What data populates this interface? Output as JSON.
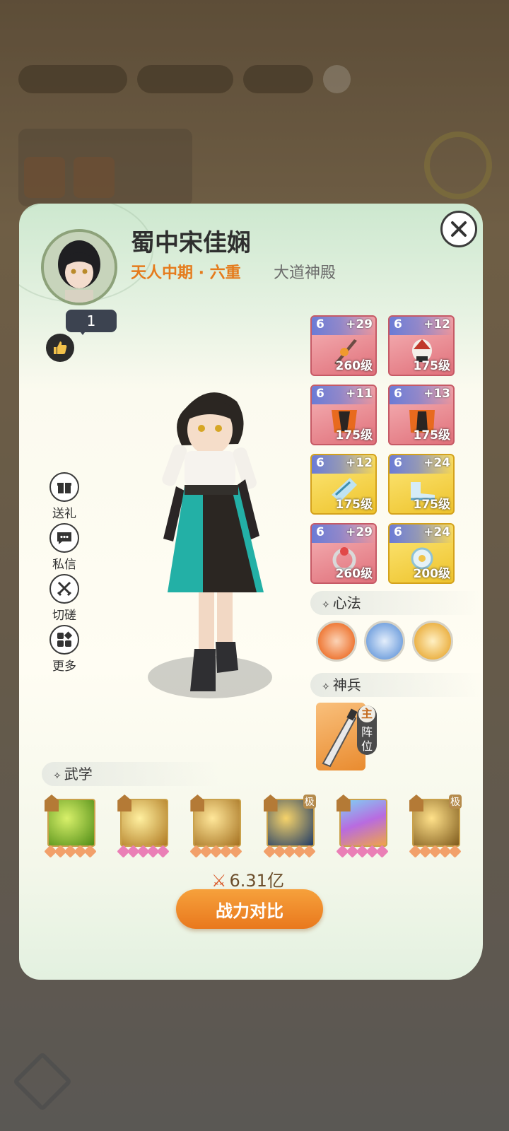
{
  "player": {
    "name": "蜀中宋佳娴",
    "realm": "天人中期 · 六重",
    "guild": "大道神殿",
    "likes": "1"
  },
  "side_actions": [
    {
      "label": "送礼",
      "icon": "gift-icon"
    },
    {
      "label": "私信",
      "icon": "chat-icon"
    },
    {
      "label": "切磋",
      "icon": "crossed-swords-icon"
    },
    {
      "label": "更多",
      "icon": "more-icon"
    }
  ],
  "equipment": [
    {
      "tier": "6",
      "plus": "+29",
      "level": "260级",
      "rarity": "red",
      "icon": "sword-icon"
    },
    {
      "tier": "6",
      "plus": "+12",
      "level": "175级",
      "rarity": "red",
      "icon": "helmet-icon"
    },
    {
      "tier": "6",
      "plus": "+11",
      "level": "175级",
      "rarity": "red",
      "icon": "armor-icon"
    },
    {
      "tier": "6",
      "plus": "+13",
      "level": "175级",
      "rarity": "red",
      "icon": "armor-icon"
    },
    {
      "tier": "6",
      "plus": "+12",
      "level": "175级",
      "rarity": "gold",
      "icon": "gauntlet-icon"
    },
    {
      "tier": "6",
      "plus": "+24",
      "level": "175级",
      "rarity": "gold",
      "icon": "boots-icon"
    },
    {
      "tier": "6",
      "plus": "+29",
      "level": "260级",
      "rarity": "red",
      "icon": "ring-icon"
    },
    {
      "tier": "6",
      "plus": "+24",
      "level": "200级",
      "rarity": "gold",
      "icon": "amulet-icon"
    }
  ],
  "sections": {
    "xinfa": "心法",
    "shenbing": "神兵",
    "wuxue": "武学"
  },
  "shenbing_tag": {
    "main": "主",
    "position": "阵位"
  },
  "skills": [
    {
      "color": "#6aa51f",
      "grade": "",
      "stars": "orange"
    },
    {
      "color": "#c98f2b",
      "grade": "",
      "stars": "pink"
    },
    {
      "color": "#c98f2b",
      "grade": "",
      "stars": "orange"
    },
    {
      "color": "#2c4f86",
      "grade": "极",
      "stars": "orange"
    },
    {
      "color": "#9b5bd1",
      "grade": "",
      "stars": "pink"
    },
    {
      "color": "#a27a2c",
      "grade": "极",
      "stars": "orange"
    }
  ],
  "combat_power": "6.31亿",
  "compare_button": "战力对比"
}
